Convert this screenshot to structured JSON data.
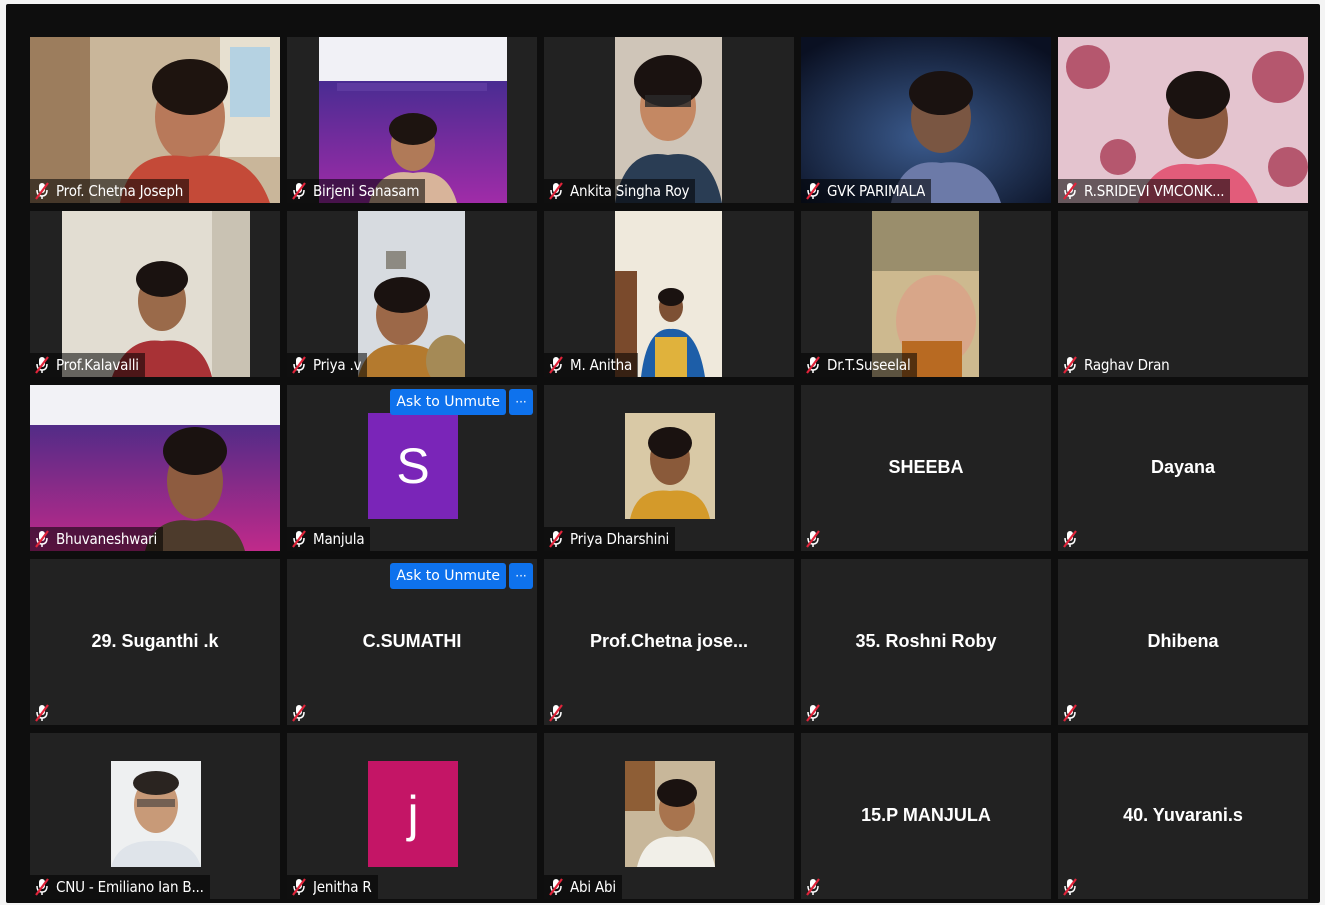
{
  "colors": {
    "tile_bg": "#222222",
    "stage_bg": "#0e0e0e",
    "mute_red": "#e0243a",
    "button_blue": "#0e72ed",
    "avatar_purple": "#7a25b8",
    "avatar_magenta": "#c41566"
  },
  "controls": {
    "ask_to_unmute": "Ask to Unmute",
    "more": "···"
  },
  "participants": [
    {
      "name": "Prof. Chetna Joseph",
      "kind": "video",
      "muted": true
    },
    {
      "name": "Birjeni Sanasam",
      "kind": "video",
      "muted": true
    },
    {
      "name": "Ankita Singha Roy",
      "kind": "video",
      "muted": true
    },
    {
      "name": "GVK PARIMALA",
      "kind": "video",
      "muted": true
    },
    {
      "name": "R.SRIDEVI VMCONK...",
      "kind": "video",
      "muted": true
    },
    {
      "name": "Prof.Kalavalli",
      "kind": "video",
      "muted": true
    },
    {
      "name": "Priya .v",
      "kind": "video",
      "muted": true
    },
    {
      "name": "M. Anitha",
      "kind": "video",
      "muted": true
    },
    {
      "name": "Dr.T.Suseelal",
      "kind": "video",
      "muted": true
    },
    {
      "name": "Raghav Dran",
      "kind": "none",
      "muted": true
    },
    {
      "name": "Bhuvaneshwari",
      "kind": "video",
      "muted": true
    },
    {
      "name": "Manjula",
      "kind": "letter",
      "letter": "S",
      "muted": true
    },
    {
      "name": "Priya Dharshini",
      "kind": "photo",
      "muted": true
    },
    {
      "name": "SHEEBA",
      "kind": "text",
      "muted": true
    },
    {
      "name": "Dayana",
      "kind": "text",
      "muted": true
    },
    {
      "name": "29. Suganthi .k",
      "kind": "text",
      "muted": true
    },
    {
      "name": "C.SUMATHI",
      "kind": "text",
      "muted": true
    },
    {
      "name": "Prof.Chetna jose...",
      "kind": "text",
      "muted": true
    },
    {
      "name": "35. Roshni Roby",
      "kind": "text",
      "muted": true
    },
    {
      "name": "Dhibena",
      "kind": "text",
      "muted": true
    },
    {
      "name": "CNU - Emiliano Ian B...",
      "kind": "photo",
      "muted": true
    },
    {
      "name": "Jenitha R",
      "kind": "letter",
      "letter": "j",
      "muted": true
    },
    {
      "name": "Abi Abi",
      "kind": "photo",
      "muted": true
    },
    {
      "name": "15.P MANJULA",
      "kind": "text",
      "muted": true
    },
    {
      "name": "40. Yuvarani.s",
      "kind": "text",
      "muted": true
    }
  ]
}
